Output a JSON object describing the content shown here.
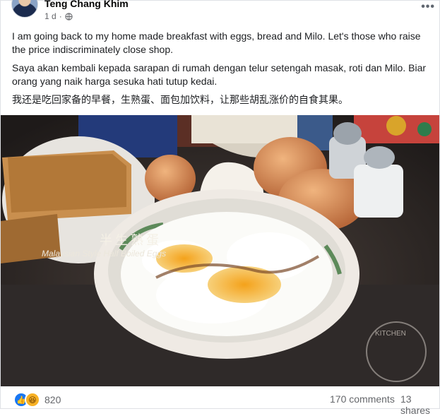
{
  "post": {
    "author": "Teng Chang Khim",
    "time": "1 d",
    "privacy_icon": "globe-icon",
    "more_icon": "more-options-icon",
    "more_label": "•••",
    "paragraphs": [
      "I am going back to my home made breakfast with eggs, bread and Milo. Let's those who raise the price indiscriminately close shop.",
      "Saya akan kembali kepada sarapan di rumah dengan telur setengah masak, roti dan Milo. Biar orang yang naik harga sesuka hati tutup kedai.",
      "我还是吃回家备的早餐，生熟蛋、面包加饮料，让那些胡乱涨价的自食其果。"
    ],
    "photo": {
      "title_zh": "半生熟蛋",
      "title_en": "Malaysian Style Half Boiled Eggs",
      "watermark_text": "KITCHEN"
    }
  },
  "footer": {
    "reaction_icons": [
      "like-reaction-icon",
      "haha-reaction-icon"
    ],
    "reaction_count": "820",
    "comments": "170 comments",
    "shares": "13 shares"
  },
  "colors": {
    "like_blue": "#1877f2",
    "haha_yellow": "#f7b125",
    "meta_gray": "#65676b"
  }
}
